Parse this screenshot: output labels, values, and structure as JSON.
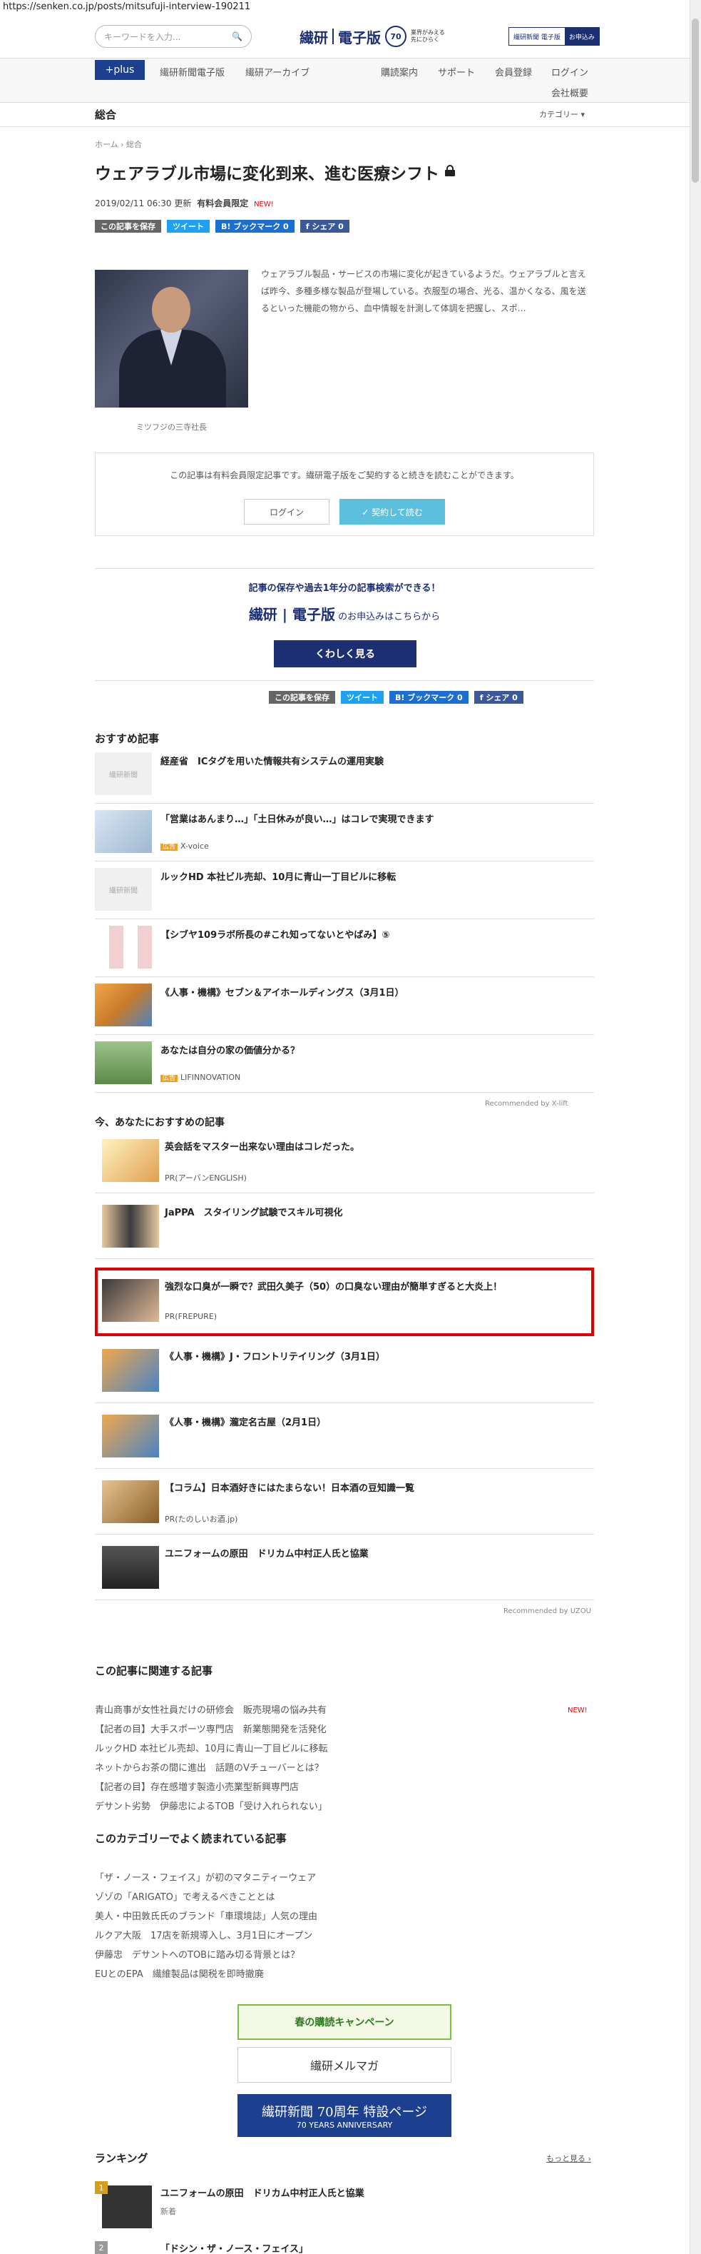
{
  "browser": {
    "url": "https://senken.co.jp/posts/mitsufuji-interview-190211"
  },
  "header": {
    "search_placeholder": "キーワードを入力...",
    "logo_main": "繊研",
    "logo_edition": "電子版",
    "logo_70": "70",
    "logo_tagline": "業界がみえる 先にひらく",
    "sub_badge_a": "繊研新聞 電子版",
    "sub_badge_b": "お申込み"
  },
  "nav": {
    "plus": "+plus",
    "items_left": [
      "繊研新聞電子版",
      "繊研アーカイブ"
    ],
    "items_right": [
      "購読案内",
      "サポート",
      "会員登録",
      "ログイン"
    ],
    "company": "会社概要"
  },
  "category": {
    "title": "総合",
    "menu": "カテゴリー ▾"
  },
  "breadcrumb": "ホーム › 総合",
  "article": {
    "title": "ウェアラブル市場に変化到来、進む医療シフト",
    "date": "2019/02/11 06:30",
    "updated": "更新",
    "member": "有料会員限定",
    "new": "NEW!",
    "caption": "ミツフジの三寺社長",
    "lead": "ウェアラブル製品・サービスの市場に変化が起きているようだ。ウェアラブルと言えば昨今、多種多様な製品が登場している。衣服型の場合、光る、温かくなる、風を送るといった機能の物から、血中情報を計測して体調を把握し、スポ…",
    "paywall_msg": "この記事は有料会員限定記事です。繊研電子版をご契約すると続きを読むことができます。",
    "login": "ログイン",
    "subscribe": "✓ 契約して読む"
  },
  "share": {
    "save": "この記事を保存",
    "tweet": "ツイート",
    "hatena": "B! ブックマーク 0",
    "fb": "f シェア 0"
  },
  "promo": {
    "headline": "記事の保存や過去1年分の記事検索ができる！",
    "line_logo": "繊研 | 電子版",
    "line_suffix": "のお申込みはこちらから",
    "button": "くわしく見る"
  },
  "recommended": {
    "title": "おすすめ記事",
    "powered": "Recommended by X-lift",
    "items": [
      {
        "title": "経産省　ICタグを用いた情報共有システムの運用実験",
        "sponsor": "",
        "thumb": "繊研新聞"
      },
      {
        "title": "「営業はあんまり…」「土日休みが良い…」はコレで実現できます",
        "sponsor": "X-voice",
        "thumb": ""
      },
      {
        "title": "ルックHD 本社ビル売却、10月に青山一丁目ビルに移転",
        "sponsor": "",
        "thumb": "繊研新聞"
      },
      {
        "title": "【シブヤ109ラボ所長の#これ知ってないとやばみ】⑤",
        "sponsor": "",
        "thumb": ""
      },
      {
        "title": "《人事・機構》セブン＆アイホールディングス（3月1日）",
        "sponsor": "",
        "thumb": ""
      },
      {
        "title": "あなたは自分の家の価値分かる？",
        "sponsor": "LIFINNOVATION",
        "thumb": ""
      }
    ],
    "ad_label": "広告"
  },
  "recommended2": {
    "title": "今、あなたにおすすめの記事",
    "powered": "Recommended by UZOU",
    "items": [
      {
        "title": "英会話をマスター出来ない理由はコレだった。",
        "pr": "PR(アーバンENGLISH)"
      },
      {
        "title": "JaPPA　スタイリング試験でスキル可視化",
        "pr": ""
      },
      {
        "title": "強烈な口臭が一瞬で？武田久美子（50）の口臭ない理由が簡単すぎると大炎上！",
        "pr": "PR(FREPURE)"
      },
      {
        "title": "《人事・機構》J・フロントリテイリング（3月1日）",
        "pr": ""
      },
      {
        "title": "《人事・機構》瀧定名古屋（2月1日）",
        "pr": ""
      },
      {
        "title": "【コラム】日本酒好きにはたまらない！日本酒の豆知識一覧",
        "pr": "PR(たのしいお酒.jp)"
      },
      {
        "title": "ユニフォームの原田　ドリカム中村正人氏と協業",
        "pr": ""
      }
    ]
  },
  "related": {
    "title": "この記事に関連する記事",
    "items": [
      "青山商事が女性社員だけの研修会　販売現場の悩み共有",
      "【記者の目】大手スポーツ専門店　新業態開発を活発化",
      "ルックHD 本社ビル売却、10月に青山一丁目ビルに移転",
      "ネットからお茶の間に進出　話題のVチューバーとは？",
      "【記者の目】存在感増す製造小売業型新興専門店",
      "デサント劣勢　伊藤忠によるTOB「受け入れられない」"
    ],
    "new": "NEW!"
  },
  "popular": {
    "title": "このカテゴリーでよく読まれている記事",
    "items": [
      "「ザ・ノース・フェイス」が初のマタニティーウェア",
      "ゾゾの「ARIGATO」で考えるべきこととは",
      "美人・中田敦氏氏のブランド「車環境誌」人気の理由",
      "ルクア大阪　17店を新規導入し、3月1日にオープン",
      "伊藤忠　デサントへのTOBに踏み切る背景とは？",
      "EUとのEPA　繊維製品は関税を即時撤廃"
    ]
  },
  "banners": {
    "b1": "春の購読キャンペーン",
    "b2": "繊研メルマガ",
    "b3": "繊研新聞 70周年 特設ページ",
    "b3_sub": "70 YEARS ANNIVERSARY"
  },
  "ranking": {
    "title": "ランキング",
    "more": "もっと見る ›",
    "items": [
      {
        "rank": "1",
        "title": "ユニフォームの原田　ドリカム中村正人氏と協業",
        "sub": "新着"
      },
      {
        "rank": "2",
        "title": "「ドシン・ザ・ノース・フェイス」",
        "sub": ""
      }
    ]
  }
}
